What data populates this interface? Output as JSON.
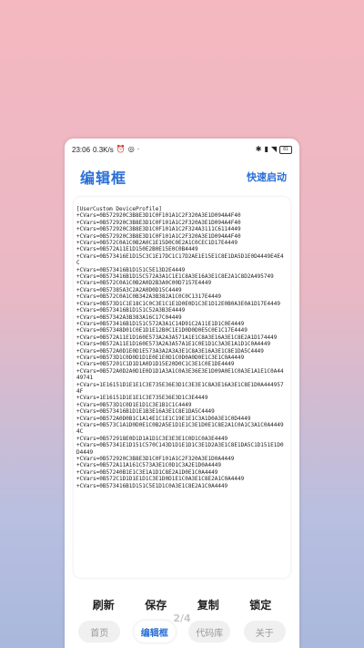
{
  "status": {
    "time": "23:06",
    "speed": "0.3K/s",
    "alarm_icon": "alarm-icon",
    "battery": "81"
  },
  "appbar": {
    "title": "编辑框",
    "quick_launch": "快速启动"
  },
  "editor": {
    "content": "[UserCustom DeviceProfile]\n+CVars=0B572920C3B8E3D1C0F101A1C2F320A3E1D094A4F40\n+CVars=0B572920C3B8E3D1C0F101A1C2F320A3E1D094A4F40\n+CVars=0B572920C3B8E3D1C0F101A1C2F324A3111C6114449\n+CVars=0B572920C3B8E3D1C0F101A1C2F320A3E1D094A4F40\n+CVars=0B572C0A1C0B2A0C1E15D0C0E2A1C0CEC1D17E4449\n+CVars=0B572A11E1D150E2B0E15E0C0B4449\n+CVars=0B573416E1D15C3C1E17DC1C17D2AE1E15E1C8E1DA5D1E0D4449E4E4C\n+CVars=0B573416B1D151C5E13D2E4449\n+CVars=0B573416B1D15C572A3A1C1E1C8A3E16A3E1C8E2A1C8D2A495749\n+CVars=0B572C0A1C0B2A0D2B3A0C00D7157E4449\n+CVars=0B57385A3C2A2A0D0D15C4449\n+CVars=0B572C0A1C0B342A3B382A1C0C0C1317E4449\n+CVars=0B573D1C1E18C1C0C3E1C1E1D0E0D1C3E1D12E0B0A3E0A1D17E4449\n+CVars=0B573416B1D151C52A3B3E4449\n+CVars=0B57342A3B383A16C17C04449\n+CVars=0B573416B1D151C572A3A1C14D91C2A11E1D1C0E4449\n+CVars=0B57348D01C0E1D1E12B0C1E1D0D0D0E5C0E1C17E4449\n+CVars=0B572A11E1D160E573A2A3A571A1E1C8A3E16A3E1C8E2A1D174449\n+CVars=0B572A11E1D160E573A2A3A57A1E1C0E1D1C3A3E1A1D1C0A4449\n+CVars=0B572A0D1E0D1E573A3A2A3A3E1C8A3E16A3E1C8E1DA5C4449\n+CVars=0B573D1C0D0D1D1E0E1E0D1C0D0A0D0E1C3E1C0A4449\n+CVars=0B57201C1D1D1A0D1D15E20D0C1C3E1C0E1DE4449\n+CVars=0B572A0D2A0D1E0D1D1A3A1C0A3E36E3E1D09A0E1C0A3E1A1E1C0A4449741\n+CVars=1E16151D1E1E1C3E735E36E3D1C3E3E1C8A3E16A3E1C8E1D0A4449574F\n+CVars=1E16151D1E1E1C3E735E36E3D1C3E4449\n+CVars=0B573D1C0D1E1D1C3E1B1C1C4449\n+CVars=0B573416B1D1E1B3E16A3E1C8E1DA5C4449\n+CVars=0B572A0D0B1C1A14E1C1E1C19E1E1C3A1D0A3E1C0D4449\n+CVars=0B573C1A1D0D0E1C0B2A5E1D1E1C3E1D0E1C8E2A1C0A1C3A1C0A44494C\n+CVars=0B572918E0D1D1A1D1C3E3E3E1C0D1C0A3E4449\n+CVars=0B57341E1D151C570C143D1D1E1D1C3E1D2A3E1C8E1DA5C1D151E1D0D4449\n+CVars=0B572920C3B8E3D1C0F101A1C2F320A3E1D0A4449\n+CVars=0B572A11A161C573A3E1C0D1C3A2E1D0A4449\n+CVars=0B57240B1E1C3E1A1D1C8E2A1D0E1C0A4449\n+CVars=0B572C1D1D1E1D1C3E1D0D1E1C0A3E1C8E2A1C0A4449\n+CVars=0B573416B1D151C5E1D1C0A3E1C8E2A1C0A4449"
  },
  "actions": {
    "refresh": "刷新",
    "save": "保存",
    "copy": "复制",
    "lock": "锁定"
  },
  "page_indicator": "2/4",
  "nav": {
    "home": "首页",
    "editor": "编辑框",
    "codebase": "代码库",
    "about": "关于"
  }
}
